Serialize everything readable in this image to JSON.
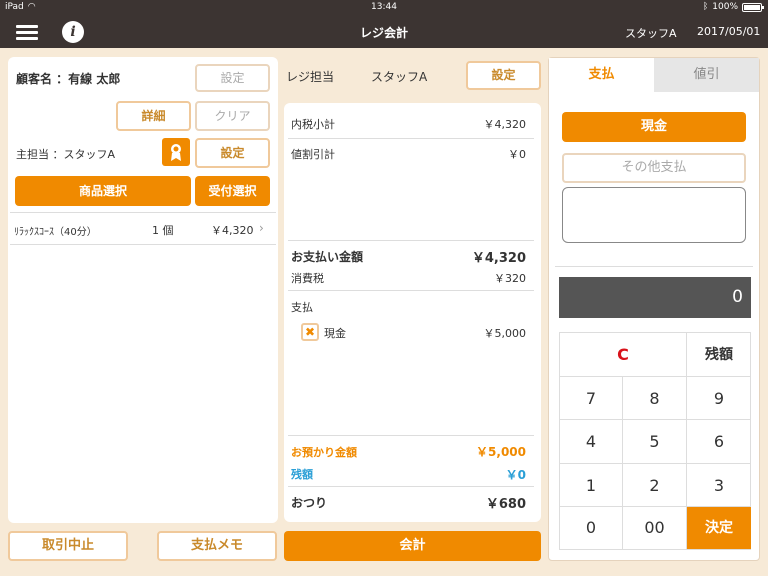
{
  "status_bar": {
    "device": "iPad",
    "time": "13:44",
    "battery": "100%"
  },
  "nav": {
    "title": "レジ会計",
    "staff": "スタッフA",
    "date": "2017/05/01"
  },
  "left": {
    "customer_label": "顧客名 ：有線 太郎",
    "customer_setting": "設定",
    "detail": "詳細",
    "clear": "クリア",
    "main_staff_label": "主担当 ：スタッフA",
    "staff_setting": "設定",
    "product_select": "商品選択",
    "reception_select": "受付選択",
    "items": [
      {
        "name": "ﾘﾗｯｸｽｺｰｽ（40分）",
        "qty": "1 個",
        "price": "￥4,320"
      }
    ]
  },
  "bottom": {
    "cancel": "取引中止",
    "memo": "支払メモ",
    "checkout": "会計"
  },
  "middle": {
    "register_staff_label": "レジ担当",
    "register_staff": "スタッフA",
    "setting": "設定",
    "subtotal_label": "内税小計",
    "subtotal": "￥4,320",
    "discount_label": "値割引計",
    "discount": "￥0",
    "total_label": "お支払い金額",
    "total": "￥4,320",
    "tax_label": "消費税",
    "tax": "￥320",
    "payment_label": "支払",
    "payments": [
      {
        "method": "現金",
        "amount": "￥5,000"
      }
    ],
    "deposit_label": "お預かり金額",
    "deposit": "￥5,000",
    "remaining_label": "残額",
    "remaining": "￥0",
    "change_label": "おつり",
    "change": "￥680"
  },
  "right": {
    "tabs": [
      {
        "label": "支払"
      },
      {
        "label": "値引"
      }
    ],
    "cash": "現金",
    "other_payment": "その他支払",
    "display_value": "0",
    "keys": {
      "c": "C",
      "remaining": "残額",
      "k7": "7",
      "k8": "8",
      "k9": "9",
      "k4": "4",
      "k5": "5",
      "k6": "6",
      "k1": "1",
      "k2": "2",
      "k3": "3",
      "k0": "0",
      "k00": "00",
      "enter": "決定"
    }
  },
  "colors": {
    "accent": "#f08a00",
    "nav_bg": "#3c3432",
    "page_bg": "#f7ead7",
    "deposit": "#f08a00",
    "remaining": "#2a9fd6",
    "c_key": "#d8121a"
  }
}
